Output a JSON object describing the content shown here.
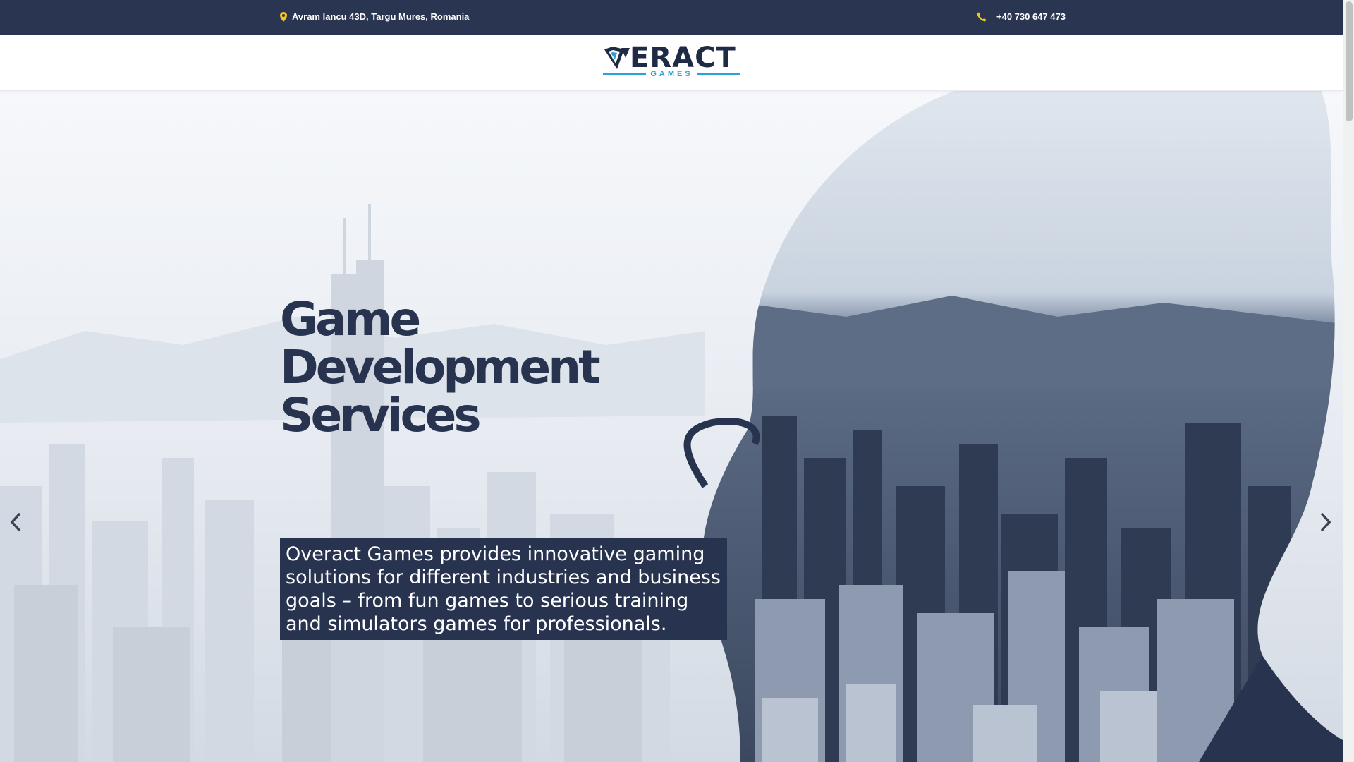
{
  "topbar": {
    "address": "Avram Iancu 43D, Targu Mures, Romania",
    "address_icon": "map-pin-icon",
    "phone": "+40 730 647 473",
    "phone_icon": "phone-icon",
    "background": "#2a3551",
    "icon_color": "#f5c518"
  },
  "header": {
    "logo_word": "ERACT",
    "logo_sub": "GAMES",
    "logo_mark_letters": "OV",
    "brand_color": "#1f2a44",
    "accent_color": "#29a3d6"
  },
  "hero": {
    "title": "Game Development Services",
    "description": "Overact Games provides innovative gaming solutions for different industries and business goals – from fun games to serious training and simulators games for professionals.",
    "prev_icon": "chevron-left-icon",
    "next_icon": "chevron-right-icon",
    "title_color": "#28334f"
  }
}
